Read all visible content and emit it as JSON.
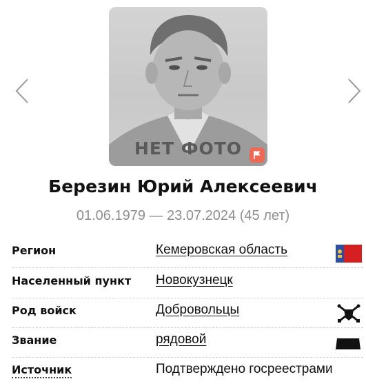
{
  "photo": {
    "placeholder_text": "НЕТ ФОТО"
  },
  "person": {
    "name": "Березин Юрий Алексеевич",
    "dates": "01.06.1979 — 23.07.2024 (45 лет)"
  },
  "details": [
    {
      "label": "Регион",
      "value": "Кемеровская область",
      "icon": "region-flag-icon"
    },
    {
      "label": "Населенный пункт",
      "value": "Новокузнецк"
    },
    {
      "label": "Род войск",
      "value": "Добровольцы",
      "icon": "crossed-swords-emblem-icon"
    },
    {
      "label": "Звание",
      "value": "рядовой",
      "icon": "rank-insignia-icon"
    },
    {
      "label": "Источник",
      "value": "Подтверждено госреестрами"
    }
  ],
  "colors": {
    "flag_badge": "#ec6a55",
    "region_flag_red": "#d42020",
    "region_flag_blue": "#2a4fa0",
    "dates_gray": "#8f8f8f"
  }
}
